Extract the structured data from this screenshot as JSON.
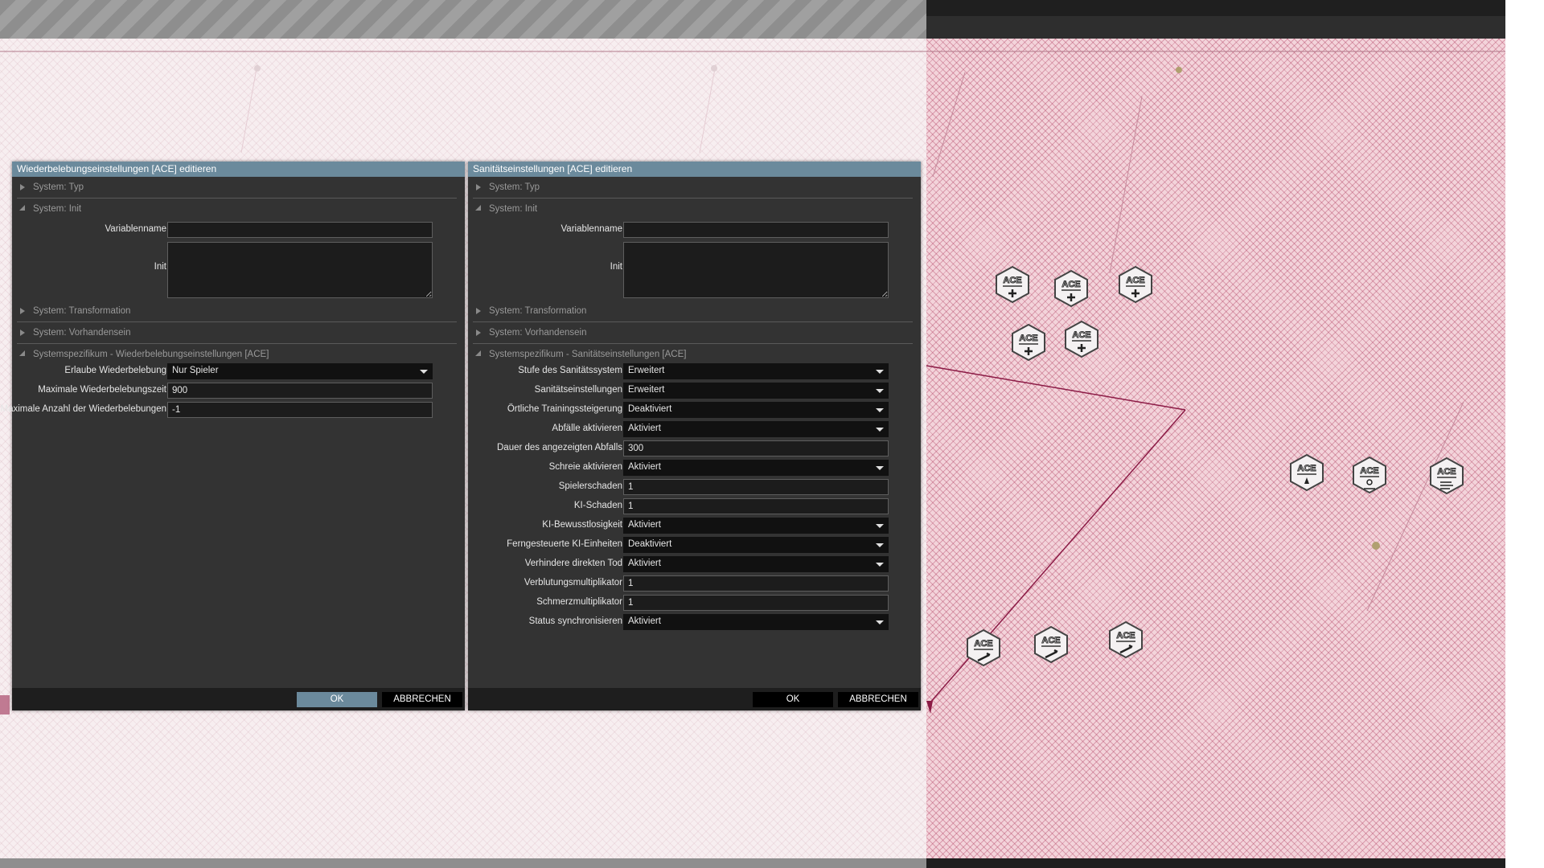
{
  "colors": {
    "title_bar": "#6b8a9c",
    "dialog_bg": "#333333",
    "map_line": "#8b1a45",
    "map_right_bg": "#f3d3da"
  },
  "dialogs": [
    {
      "title": "Wiederbelebungseinstellungen [ACE] editieren",
      "sections": {
        "typ": "System: Typ",
        "init": "System: Init",
        "transformation": "System: Transformation",
        "vorhandensein": "System: Vorhandensein",
        "spezifikum": "Systemspezifikum - Wiederbelebungseinstellungen [ACE]"
      },
      "init_fields": {
        "variablenname_label": "Variablenname",
        "variablenname_value": "",
        "init_label": "Init",
        "init_value": ""
      },
      "fields": [
        {
          "label": "Erlaube Wiederbelebung",
          "value": "Nur Spieler",
          "kind": "select"
        },
        {
          "label": "Maximale Wiederbelebungszeit",
          "value": "900",
          "kind": "input"
        },
        {
          "label": "Maximale Anzahl der Wiederbelebungen",
          "value": "-1",
          "kind": "input"
        }
      ],
      "ok": "OK",
      "cancel": "ABBRECHEN"
    },
    {
      "title": "Sanitätseinstellungen [ACE] editieren",
      "sections": {
        "typ": "System: Typ",
        "init": "System: Init",
        "transformation": "System: Transformation",
        "vorhandensein": "System: Vorhandensein",
        "spezifikum": "Systemspezifikum - Sanitätseinstellungen [ACE]"
      },
      "init_fields": {
        "variablenname_label": "Variablenname",
        "variablenname_value": "",
        "init_label": "Init",
        "init_value": ""
      },
      "fields": [
        {
          "label": "Stufe des Sanitätssystem",
          "value": "Erweitert",
          "kind": "select"
        },
        {
          "label": "Sanitätseinstellungen",
          "value": "Erweitert",
          "kind": "select"
        },
        {
          "label": "Örtliche Trainingssteigerung",
          "value": "Deaktiviert",
          "kind": "select"
        },
        {
          "label": "Abfälle aktivieren",
          "value": "Aktiviert",
          "kind": "select"
        },
        {
          "label": "Dauer des angezeigten Abfalls",
          "value": "300",
          "kind": "input"
        },
        {
          "label": "Schreie aktivieren",
          "value": "Aktiviert",
          "kind": "select"
        },
        {
          "label": "Spielerschaden",
          "value": "1",
          "kind": "input"
        },
        {
          "label": "KI-Schaden",
          "value": "1",
          "kind": "input"
        },
        {
          "label": "KI-Bewusstlosigkeit",
          "value": "Aktiviert",
          "kind": "select"
        },
        {
          "label": "Ferngesteuerte KI-Einheiten",
          "value": "Deaktiviert",
          "kind": "select"
        },
        {
          "label": "Verhindere direkten Tod",
          "value": "Aktiviert",
          "kind": "select"
        },
        {
          "label": "Verblutungsmultiplikator",
          "value": "1",
          "kind": "input"
        },
        {
          "label": "Schmerzmultiplikator",
          "value": "1",
          "kind": "input"
        },
        {
          "label": "Status synchronisieren",
          "value": "Aktiviert",
          "kind": "select"
        }
      ],
      "ok": "OK",
      "cancel": "ABBRECHEN"
    }
  ],
  "map_markers": {
    "label": "ACE",
    "items": [
      {
        "icon": "medical-cross-icon"
      },
      {
        "icon": "medical-cross-icon"
      },
      {
        "icon": "medical-cross-icon"
      },
      {
        "icon": "medical-cross-icon"
      },
      {
        "icon": "medical-cross-icon"
      },
      {
        "icon": "hand-icon"
      },
      {
        "icon": "person-icon"
      },
      {
        "icon": "wind-icon"
      },
      {
        "icon": "wrench-icon"
      },
      {
        "icon": "wrench-icon"
      },
      {
        "icon": "wrench-icon"
      }
    ]
  }
}
